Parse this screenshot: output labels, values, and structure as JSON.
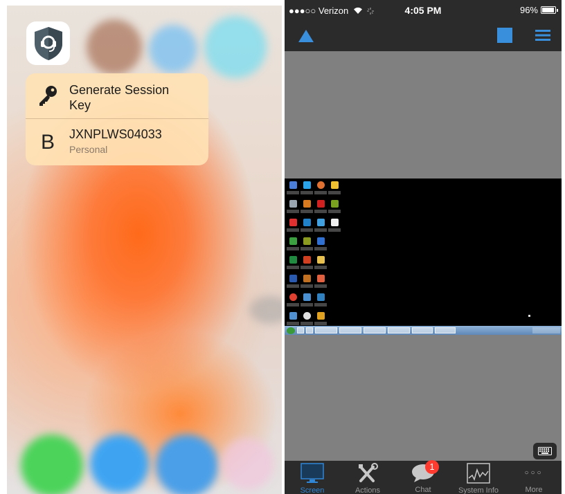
{
  "quick_action_menu": {
    "items": [
      {
        "title": "Generate Session Key",
        "icon": "key-icon"
      },
      {
        "title": "JXNPLWS04033",
        "subtitle": "Personal",
        "icon": "letter-b-icon"
      }
    ]
  },
  "status_bar": {
    "carrier": "●●●○○ Verizon",
    "time": "4:05 PM",
    "battery": "96%",
    "battery_level": 0.96
  },
  "nav_bar": {
    "left_icon": "triangle-icon",
    "square_icon": "square-icon",
    "menu_icon": "hamburger-menu-icon"
  },
  "tab_bar": {
    "tabs": [
      {
        "label": "Screen",
        "icon": "monitor-icon",
        "active": true
      },
      {
        "label": "Actions",
        "icon": "tools-icon",
        "active": false
      },
      {
        "label": "Chat",
        "icon": "chat-bubble-icon",
        "badge": "1",
        "active": false
      },
      {
        "label": "System Info",
        "icon": "activity-graph-icon",
        "active": false
      },
      {
        "label": "More",
        "icon": "more-dots-icon",
        "active": false
      }
    ]
  },
  "colors": {
    "accent": "#2f86d6",
    "badge": "#ff3b30",
    "bar_background": "#2b2b2b",
    "canvas_gray": "#808080"
  }
}
